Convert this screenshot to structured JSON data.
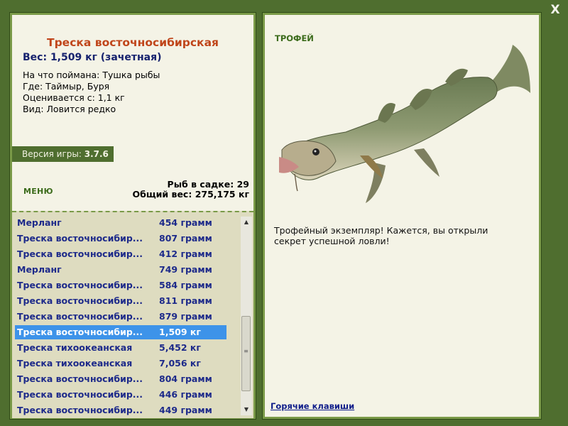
{
  "window": {
    "close_label": "X"
  },
  "fish": {
    "name": "Треска восточносибирская",
    "weight_line": "Вес: 1,509 кг (зачетная)",
    "caught_on": "На что поймана: Тушка рыбы",
    "where": "Где: Таймыр, Буря",
    "scored_from": "Оценивается с: 1,1 кг",
    "kind": "Вид: Ловится редко"
  },
  "version": {
    "label": "Версия игры:",
    "value": "3.7.6"
  },
  "menu": {
    "label": "МЕНЮ"
  },
  "stats": {
    "fish_count": "Рыб в садке: 29",
    "total_weight": "Общий вес: 275,175 кг"
  },
  "catches": [
    {
      "name": "Мерланг",
      "weight": "454 грамм",
      "selected": false
    },
    {
      "name": "Треска восточносибир...",
      "weight": "807 грамм",
      "selected": false
    },
    {
      "name": "Треска восточносибир...",
      "weight": "412 грамм",
      "selected": false
    },
    {
      "name": "Мерланг",
      "weight": "749 грамм",
      "selected": false
    },
    {
      "name": "Треска восточносибир...",
      "weight": "584 грамм",
      "selected": false
    },
    {
      "name": "Треска восточносибир...",
      "weight": "811 грамм",
      "selected": false
    },
    {
      "name": "Треска восточносибир...",
      "weight": "879 грамм",
      "selected": false
    },
    {
      "name": "Треска восточносибир...",
      "weight": "1,509 кг",
      "selected": true
    },
    {
      "name": "Треска тихоокеанская",
      "weight": "5,452 кг",
      "selected": false
    },
    {
      "name": "Треска тихоокеанская",
      "weight": "7,056 кг",
      "selected": false
    },
    {
      "name": "Треска восточносибир...",
      "weight": "804 грамм",
      "selected": false
    },
    {
      "name": "Треска восточносибир...",
      "weight": "446 грамм",
      "selected": false
    },
    {
      "name": "Треска восточносибир...",
      "weight": "449 грамм",
      "selected": false
    }
  ],
  "trophy": {
    "label": "ТРОФЕЙ",
    "description": "Трофейный экземпляр! Кажется, вы открыли секрет успешной ловли!"
  },
  "hotkeys": {
    "label": "Горячие клавиши"
  },
  "colors": {
    "background": "#4f6e2f",
    "panel": "#f4f3e6",
    "fish_name": "#c0461b",
    "list_text": "#1d2a8a",
    "selected_row": "#3d93e9"
  },
  "icons": {
    "close": "close-icon",
    "scroll_up": "arrow-up-icon",
    "scroll_down": "arrow-down-icon"
  }
}
